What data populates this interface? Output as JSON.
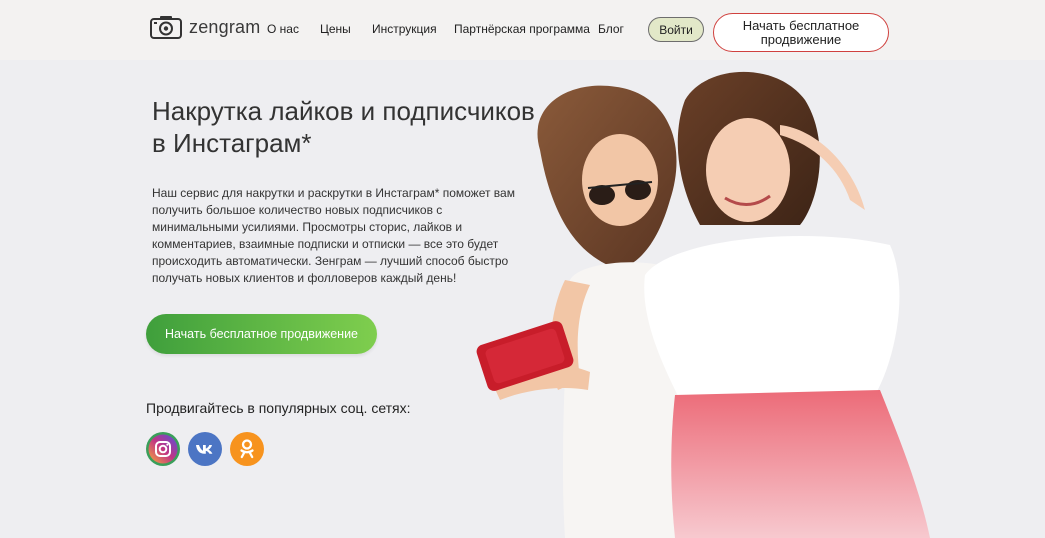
{
  "brand": {
    "name": "zengram",
    "icon": "camera-logo-icon"
  },
  "nav": {
    "items": [
      {
        "label": "О нас"
      },
      {
        "label": "Цены"
      },
      {
        "label": "Инструкция"
      },
      {
        "label": "Партнёрская программа"
      },
      {
        "label": "Блог"
      }
    ],
    "login_label": "Войти",
    "cta_label": "Начать бесплатное продвижение"
  },
  "hero": {
    "title_line1": "Накрутка лайков и подписчиков",
    "title_line2": "в  Инстаграм*",
    "description": "Наш сервис для накрутки и раскрутки в Инстаграм* поможет вам получить большое количество новых подписчиков с минимальными усилиями. Просмотры сторис, лайков и комментариев, взаимные подписки и отписки — все это будет происходить автоматически. Зенграм — лучший способ быстро получать новых клиентов и фолловеров каждый день!",
    "cta_label": "Начать бесплатное продвижение"
  },
  "social": {
    "title": "Продвигайтесь в популярных соц. сетях:",
    "networks": [
      {
        "icon": "instagram-icon",
        "color": "#c13584"
      },
      {
        "icon": "vk-icon",
        "color": "#4c75c4"
      },
      {
        "icon": "odnoklassniki-icon",
        "color": "#f7931e"
      }
    ]
  },
  "colors": {
    "accent_green": "#3f9f3c",
    "accent_red": "#d0413e",
    "header_bg": "#f3f2f1",
    "page_bg": "#eeeef1"
  }
}
